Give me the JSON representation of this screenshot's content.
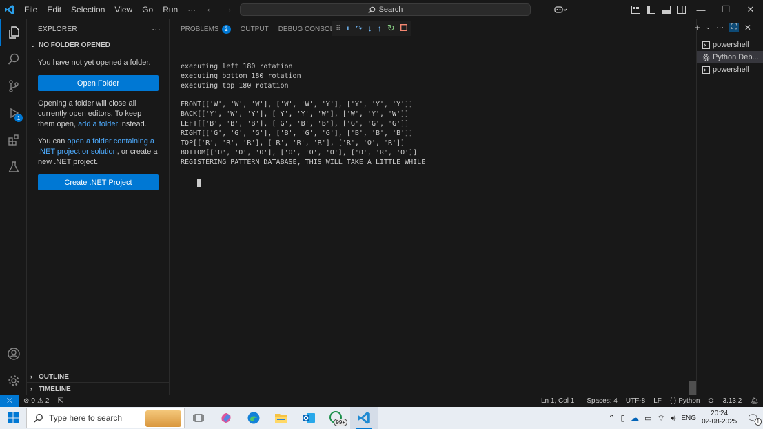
{
  "titlebar": {
    "menu": [
      "File",
      "Edit",
      "Selection",
      "View",
      "Go",
      "Run",
      "···"
    ],
    "search_placeholder": "Search"
  },
  "sidebar": {
    "header": "EXPLORER",
    "more": "···",
    "section_title": "NO FOLDER OPENED",
    "no_folder_text": "You have not yet opened a folder.",
    "open_folder_button": "Open Folder",
    "close_editors_text_1": "Opening a folder will close all currently open editors. To keep them open, ",
    "add_folder_link": "add a folder",
    "close_editors_text_2": " instead.",
    "net_text_1": "You can ",
    "net_link": "open a folder containing a .NET project or solution",
    "net_text_2": ", or create a new .NET project.",
    "create_net_button": "Create .NET Project",
    "outline": "OUTLINE",
    "timeline": "TIMELINE"
  },
  "activity": {
    "run_debug_badge": "1"
  },
  "panel": {
    "tabs": [
      {
        "label": "PROBLEMS",
        "count": "2"
      },
      {
        "label": "OUTPUT"
      },
      {
        "label": "DEBUG CONSOLE"
      }
    ],
    "terminal_lines": [
      "executing left 180 rotation",
      "executing bottom 180 rotation",
      "executing top 180 rotation",
      "",
      "FRONT[['W', 'W', 'W'], ['W', 'W', 'Y'], ['Y', 'Y', 'Y']]",
      "BACK[['Y', 'W', 'Y'], ['Y', 'Y', 'W'], ['W', 'Y', 'W']]",
      "LEFT[['B', 'B', 'B'], ['G', 'B', 'B'], ['G', 'G', 'G']]",
      "RIGHT[['G', 'G', 'G'], ['B', 'G', 'G'], ['B', 'B', 'B']]",
      "TOP[['R', 'R', 'R'], ['R', 'R', 'R'], ['R', 'O', 'R']]",
      "BOTTOM[['O', 'O', 'O'], ['O', 'O', 'O'], ['O', 'R', 'O']]",
      "REGISTERING PATTERN DATABASE, THIS WILL TAKE A LITTLE WHILE"
    ]
  },
  "terminals": [
    {
      "label": "powershell",
      "icon": "terminal-icon"
    },
    {
      "label": "Python Deb...",
      "icon": "gear-icon",
      "selected": true
    },
    {
      "label": "powershell",
      "icon": "terminal-icon"
    }
  ],
  "statusbar": {
    "errors": "0",
    "warnings": "2",
    "position": "Ln 1, Col 1",
    "spaces": "Spaces: 4",
    "encoding": "UTF-8",
    "eol": "LF",
    "language": "Python",
    "python_version": "3.13.2"
  },
  "taskbar": {
    "search_placeholder": "Type here to search",
    "whatsapp_badge": "99+",
    "language": "ENG",
    "time": "20:24",
    "date": "02-08-2025",
    "notification_count": "1"
  },
  "colors": {
    "accent": "#0078d4",
    "link": "#4daafc",
    "background": "#181818"
  }
}
